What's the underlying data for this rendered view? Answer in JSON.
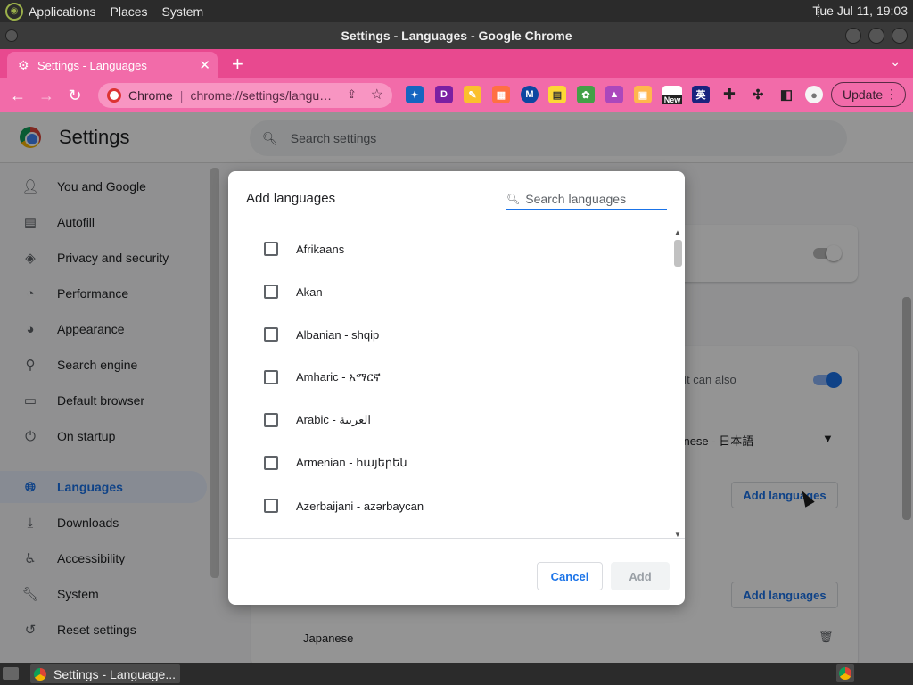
{
  "top_panel": {
    "menus": [
      "Applications",
      "Places",
      "System"
    ],
    "clock": "Tue Jul 11, 19:03"
  },
  "window": {
    "title": "Settings - Languages - Google Chrome"
  },
  "browser": {
    "tab_title": "Settings - Languages",
    "omnibox_site": "Chrome",
    "omnibox_url": "chrome://settings/langu…",
    "update_label": "Update",
    "extension_badge": "New",
    "theme_color": "#f26ba9"
  },
  "settings": {
    "title": "Settings",
    "search_placeholder": "Search settings",
    "sidebar": [
      {
        "label": "You and Google",
        "icon": "person-icon"
      },
      {
        "label": "Autofill",
        "icon": "clipboard-icon"
      },
      {
        "label": "Privacy and security",
        "icon": "shield-icon"
      },
      {
        "label": "Performance",
        "icon": "speedometer-icon"
      },
      {
        "label": "Appearance",
        "icon": "palette-icon"
      },
      {
        "label": "Search engine",
        "icon": "search-icon"
      },
      {
        "label": "Default browser",
        "icon": "browser-icon"
      },
      {
        "label": "On startup",
        "icon": "power-icon"
      },
      {
        "label": "Languages",
        "icon": "globe-icon",
        "active": true
      },
      {
        "label": "Downloads",
        "icon": "download-icon"
      },
      {
        "label": "Accessibility",
        "icon": "accessibility-icon"
      },
      {
        "label": "System",
        "icon": "wrench-icon"
      },
      {
        "label": "Reset settings",
        "icon": "history-icon"
      }
    ],
    "background": {
      "partial_text": "e. It can also",
      "dropdown_value": "panese - 日本語",
      "add_languages_1": "Add languages",
      "add_languages_2": "Add languages",
      "language_entry": "Japanese"
    }
  },
  "dialog": {
    "title": "Add languages",
    "search_placeholder": "Search languages",
    "languages": [
      "Afrikaans",
      "Akan",
      "Albanian - shqip",
      "Amharic - አማርኛ",
      "Arabic - العربية",
      "Armenian - հայերեն",
      "Azerbaijani - azərbaycan"
    ],
    "cancel_label": "Cancel",
    "add_label": "Add"
  },
  "taskbar": {
    "task_label": "Settings - Language..."
  }
}
